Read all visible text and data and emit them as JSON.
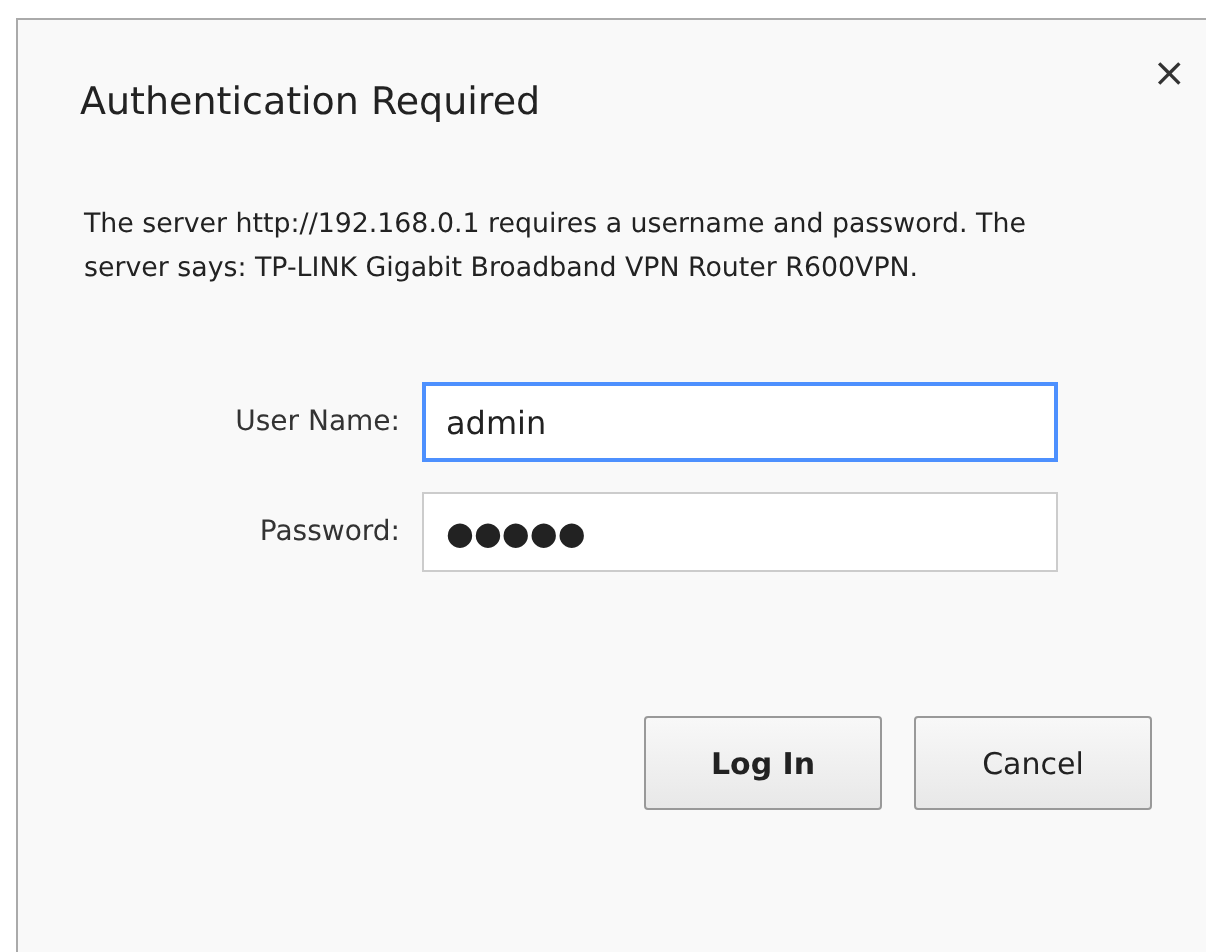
{
  "dialog": {
    "title": "Authentication Required",
    "close": "×",
    "message": "The server http://192.168.0.1 requires a username and password. The server says: TP-LINK Gigabit Broadband VPN Router R600VPN.",
    "fields": [
      {
        "label": "User Name:",
        "value": "admin",
        "focused": true
      },
      {
        "label": "Password:",
        "value": "●●●●●",
        "focused": false
      }
    ],
    "buttons": [
      {
        "label": "Log In",
        "default": true
      },
      {
        "label": "Cancel",
        "default": false
      }
    ]
  }
}
